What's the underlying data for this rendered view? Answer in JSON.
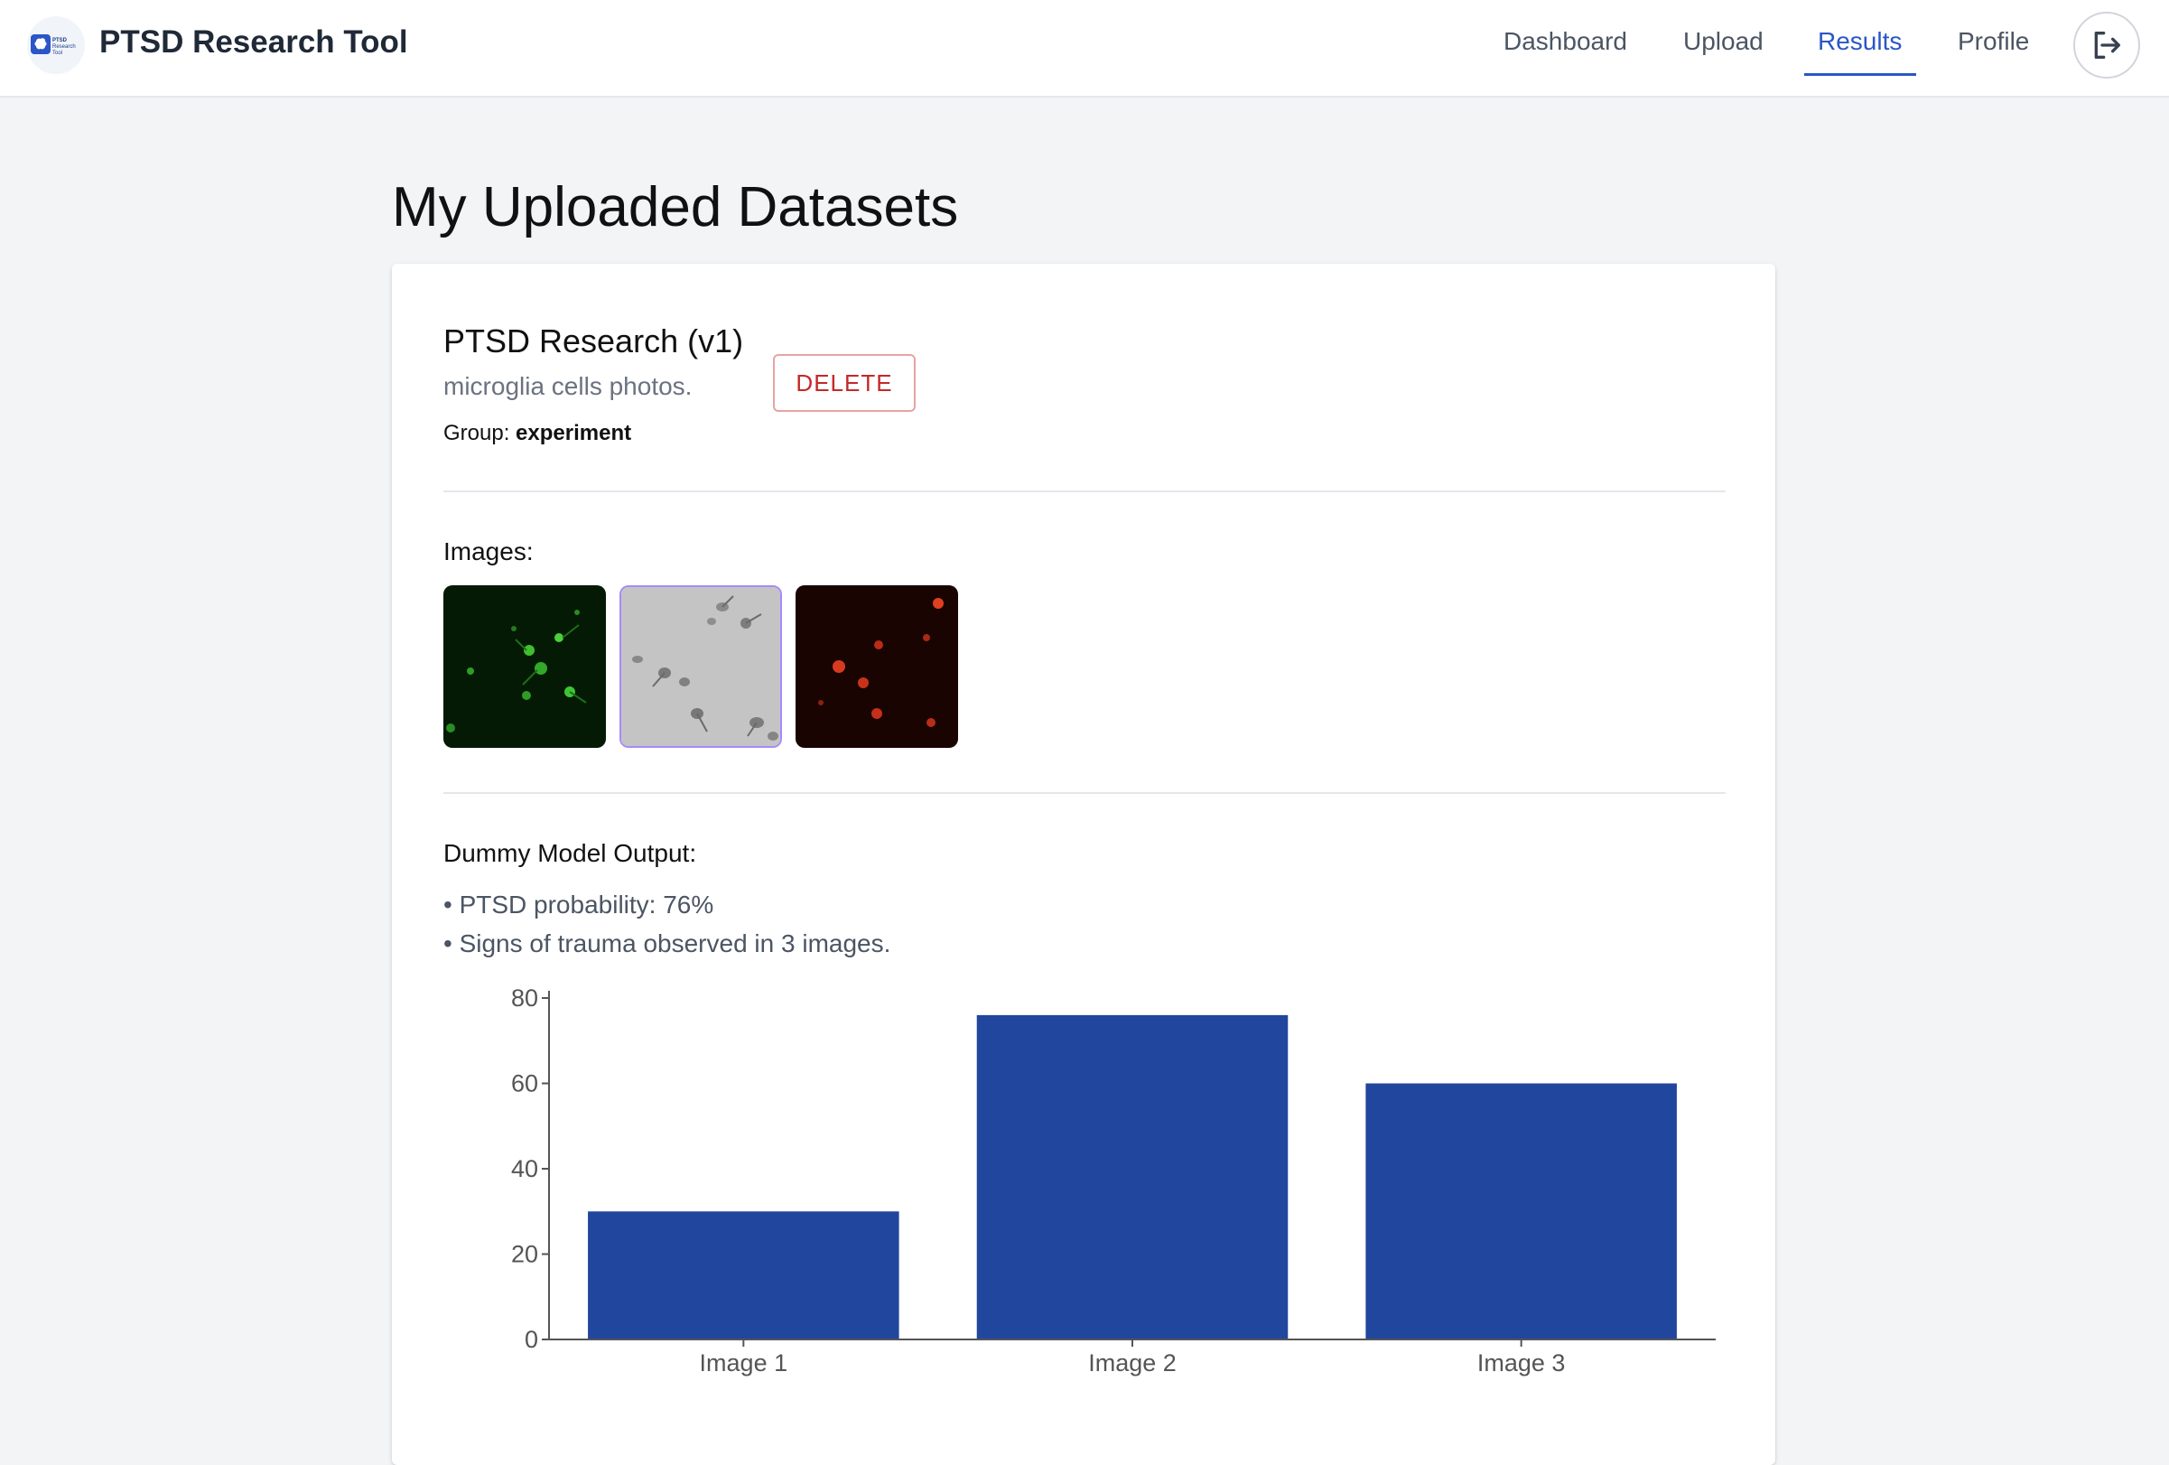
{
  "header": {
    "app_title": "PTSD Research Tool",
    "logo_text": "PTSD Research Tool",
    "logo_icon": "brain-icon",
    "nav": [
      {
        "label": "Dashboard",
        "active": false
      },
      {
        "label": "Upload",
        "active": false
      },
      {
        "label": "Results",
        "active": true
      },
      {
        "label": "Profile",
        "active": false
      }
    ],
    "logout_icon": "logout-icon",
    "accent_color": "#2a56c6"
  },
  "page": {
    "title": "My Uploaded Datasets"
  },
  "dataset": {
    "title": "PTSD Research (v1)",
    "description": "microglia cells photos.",
    "group_label": "Group:",
    "group_value": "experiment",
    "delete_label": "DELETE",
    "images_label": "Images:",
    "images": [
      {
        "kind": "green fluorescence microscopy"
      },
      {
        "kind": "grayscale brightfield microscopy"
      },
      {
        "kind": "red fluorescence microscopy"
      }
    ],
    "output_label": "Dummy Model Output:",
    "output_lines": [
      "• PTSD probability: 76%",
      "• Signs of trauma observed in 3 images."
    ]
  },
  "chart_data": {
    "type": "bar",
    "categories": [
      "Image 1",
      "Image 2",
      "Image 3"
    ],
    "values": [
      30,
      76,
      60
    ],
    "ylim": [
      0,
      80
    ],
    "yticks": [
      0,
      20,
      40,
      60,
      80
    ],
    "bar_color": "#21469d",
    "grid": false,
    "legend": "none"
  }
}
